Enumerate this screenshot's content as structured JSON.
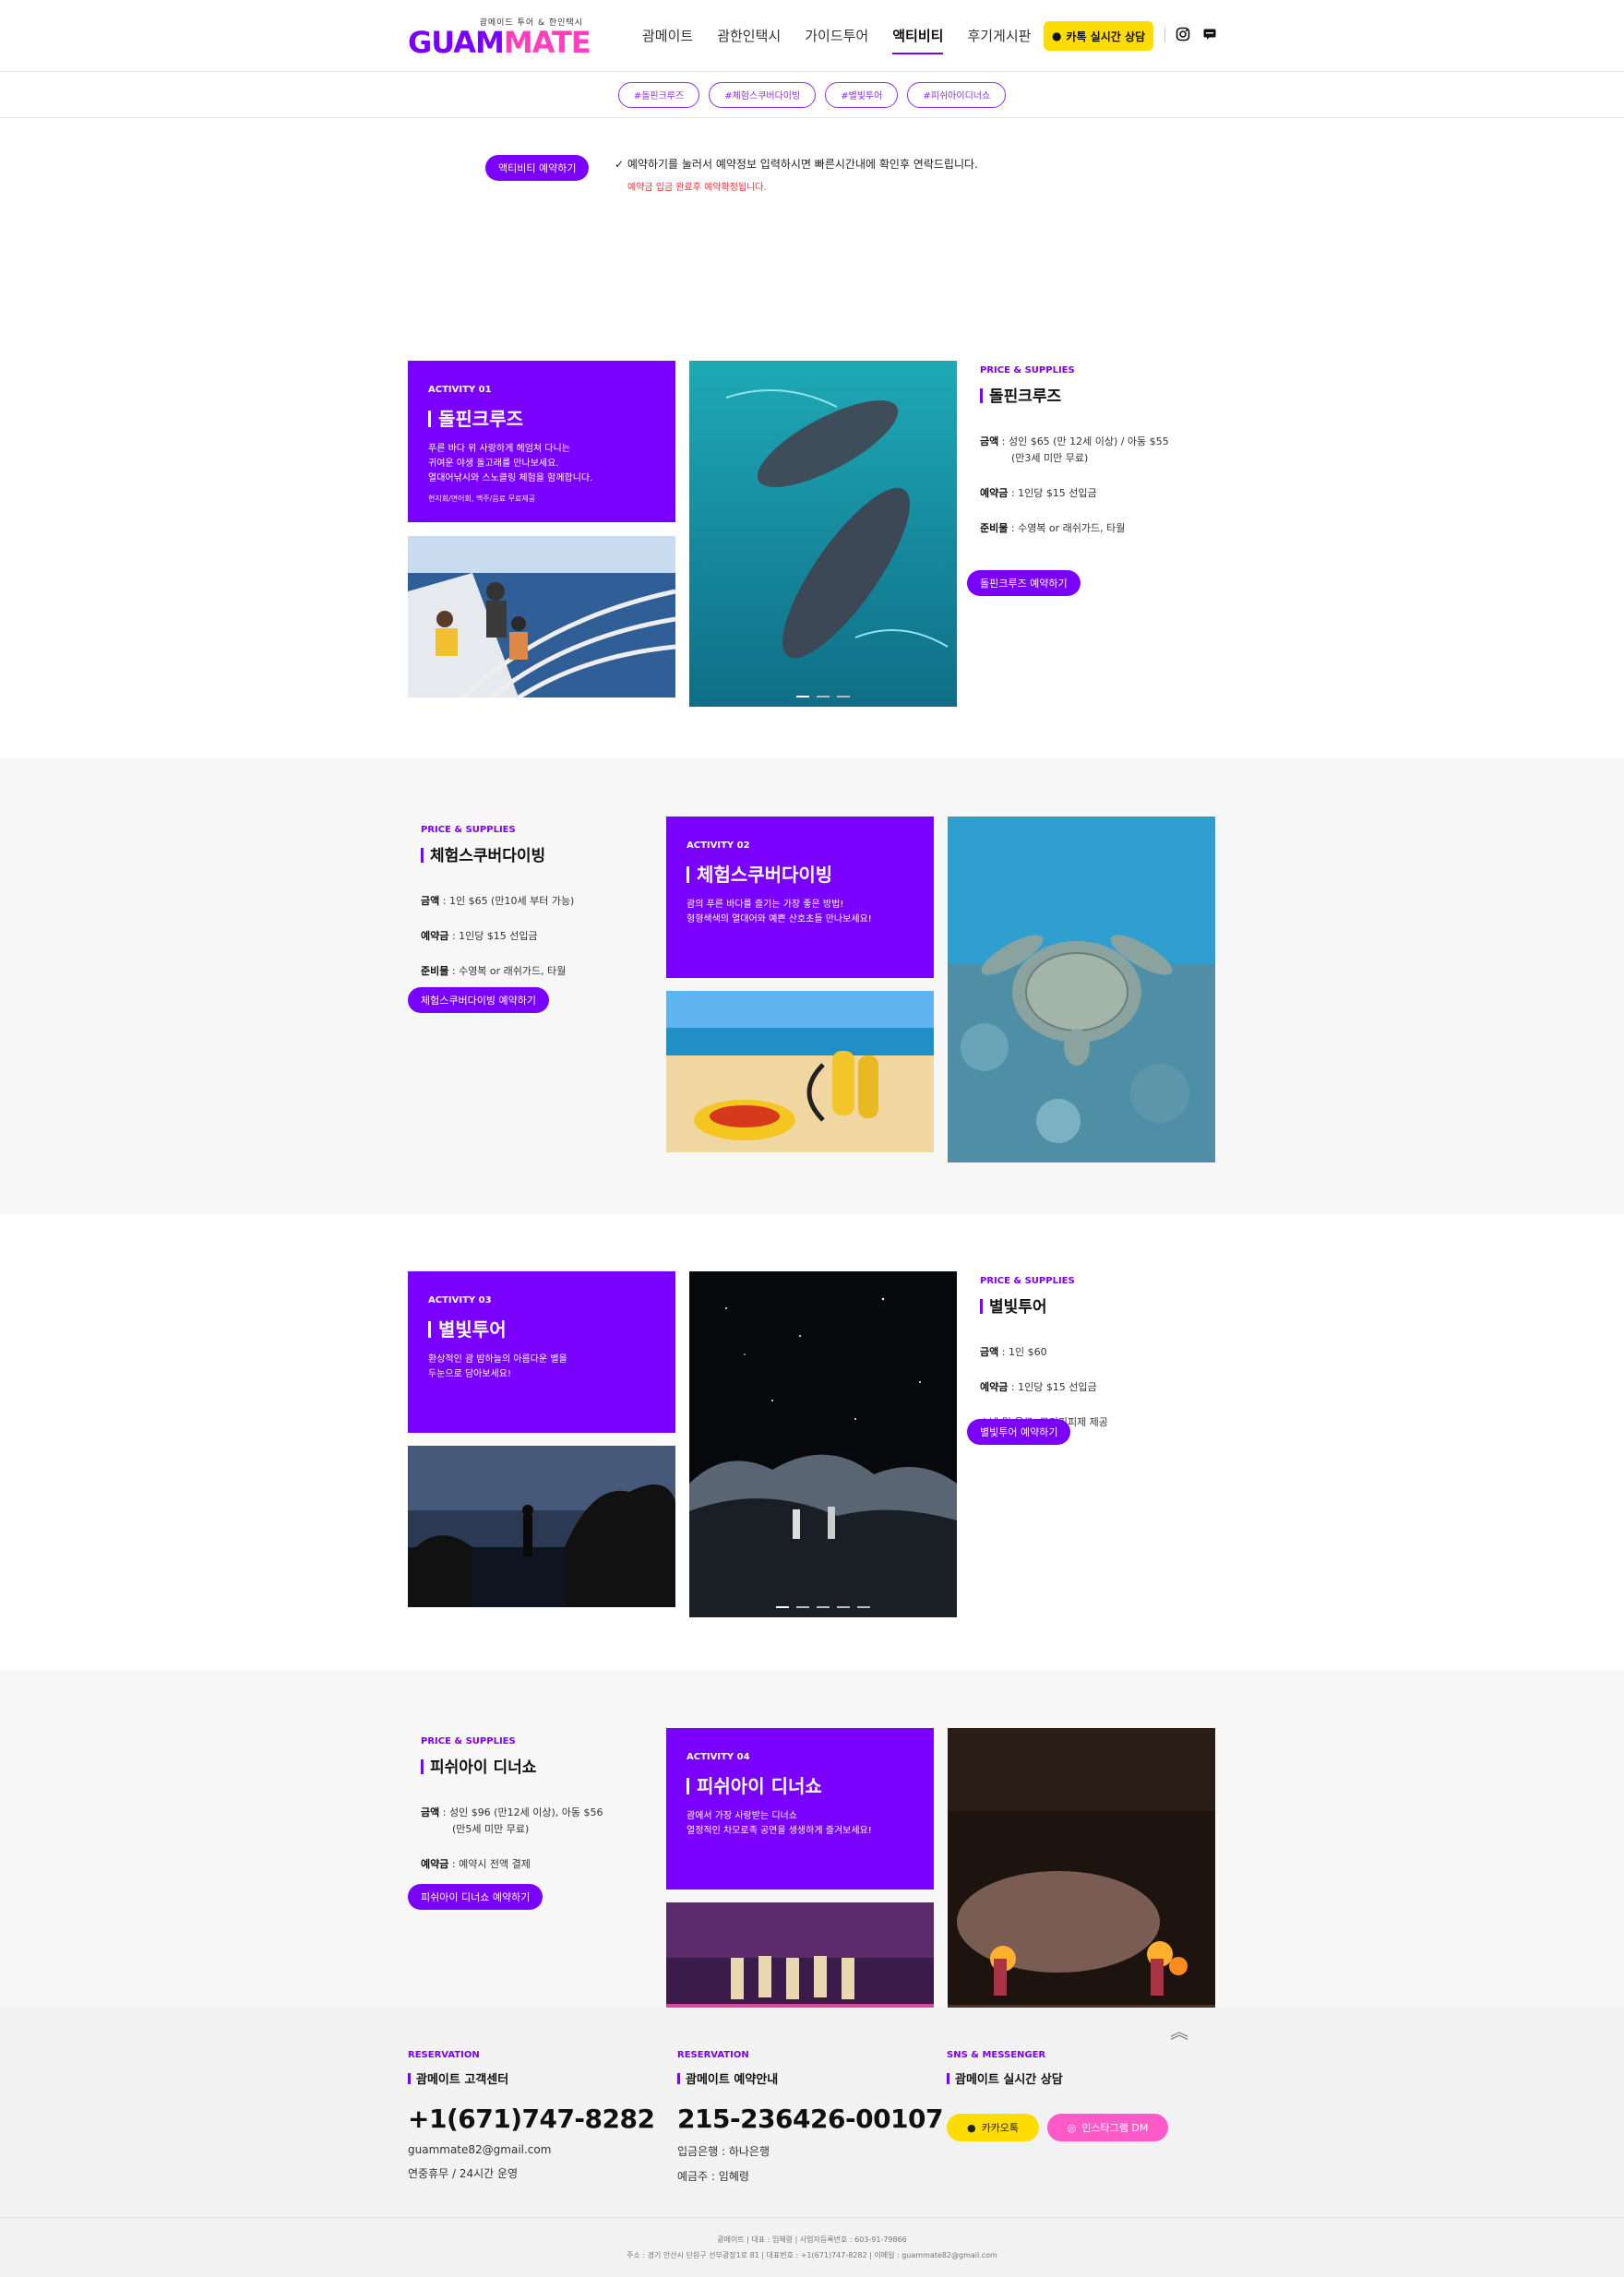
{
  "header": {
    "logo_sub": "괌메이드 투어 & 한인택시",
    "logo_a": "GUAM",
    "logo_b": "MATE",
    "nav": [
      "괌메이트",
      "괌한인택시",
      "가이드투어",
      "액티비티",
      "후기게시판"
    ],
    "active_nav": "액티비티",
    "kakao_label": "카톡 실시간 상담",
    "icons": [
      "instagram-icon",
      "chat-icon"
    ]
  },
  "tags": [
    "#돌핀크루즈",
    "#체험스쿠버다이빙",
    "#별빛투어",
    "#피쉬아이디너쇼"
  ],
  "notice": {
    "button": "액티비티 예약하기",
    "line1": "✓ 예약하기를 눌러서 예약정보 입력하시면 빠른시간내에 확인후 연락드립니다.",
    "line2": "예약금 입금 완료후 예약확정됩니다."
  },
  "activities": [
    {
      "kicker": "ACTIVITY 01",
      "title": "돌핀크루즈",
      "desc1": "푸른 바다 위 사랑하게 헤엄쳐 다니는",
      "desc2": "귀여운 야생 돌고래를 만나보세요.",
      "desc3": "열대어낚시와 스노클링 체험을 함께합니다.",
      "small": "현지회/면어회, 맥주/음료 무료제공",
      "price_kicker": "PRICE & SUPPLIES",
      "price_title": "돌핀크루즈",
      "price_label": "금액",
      "price_value": "성인 $65 (만 12세 이상) / 아동 $55",
      "price_value2": "(만3세 미만 무료)",
      "deposit_label": "예약금",
      "deposit_value": "1인당 $15 선입금",
      "prep_label": "준비물",
      "prep_value": "수영복 or 래쉬가드, 타월",
      "book_button": "돌핀크루즈 예약하기"
    },
    {
      "kicker": "ACTIVITY 02",
      "title": "체험스쿠버다이빙",
      "desc1": "괌의 푸른 바다를 즐기는 가장 좋은 방법!",
      "desc2": "형형색색의 열대어와 예쁜 산호초들 만나보세요!",
      "price_kicker": "PRICE & SUPPLIES",
      "price_title": "체험스쿠버다이빙",
      "price_label": "금액",
      "price_value": "1인 $65 (만10세 부터 가능)",
      "deposit_label": "예약금",
      "deposit_value": "1인당 $15 선입금",
      "prep_label": "준비물",
      "prep_value": "수영복 or 래쉬가드, 타월",
      "book_button": "체험스쿠버다이빙 예약하기"
    },
    {
      "kicker": "ACTIVITY 03",
      "title": "별빛투어",
      "desc1": "환상적인 괌 밤하늘의 아름다운 별을",
      "desc2": "두눈으로 담아보세요!",
      "price_kicker": "PRICE & SUPPLIES",
      "price_title": "별빛투어",
      "price_label": "금액",
      "price_value": "1인 $60",
      "deposit_label": "예약금",
      "deposit_value": "1인당 $15 선입금",
      "extra": "스낵 및 음료, 모기기피제 제공",
      "book_button": "별빛투어 예약하기"
    },
    {
      "kicker": "ACTIVITY 04",
      "title": "피쉬아이 디너쇼",
      "desc1": "괌에서 가장 사랑받는 디너쇼",
      "desc2": "열정적인 차모로족 공연을 생생하게 즐겨보세요!",
      "price_kicker": "PRICE & SUPPLIES",
      "price_title": "피쉬아이 디너쇼",
      "price_label": "금액",
      "price_value": "성인 $96 (만12세 이상), 아동 $56",
      "price_value2": "(만5세 미만 무료)",
      "deposit_label": "예약금",
      "deposit_value": "예약시 전액 결제",
      "book_button": "피쉬아이 디너쇼 예약하기"
    }
  ],
  "footer": {
    "col1": {
      "kicker": "RESERVATION",
      "title": "괌메이트 고객센터",
      "phone": "+1(671)747-8282",
      "email": "guammate82@gmail.com",
      "hours": "연중휴무 / 24시간 운영"
    },
    "col2": {
      "kicker": "RESERVATION",
      "title": "괌메이트 예약안내",
      "account": "215-236426-00107",
      "bank": "입금은행 : 하나은행",
      "holder": "예금주 : 임혜령"
    },
    "col3": {
      "kicker": "SNS & MESSENGER",
      "title": "괌메이트 실시간 상담",
      "kakao": "카카오톡",
      "insta": "인스타그램 DM"
    },
    "line1": "괌메이트 | 대표 : 임혜령 | 사업자등록번호 : 603-91-79866",
    "line2": "주소 : 경기 안산시 단원구 선부광장1로 81 | 대표번호 : +1(671)747-8282 | 이메일 : guammate82@gmail.com"
  }
}
